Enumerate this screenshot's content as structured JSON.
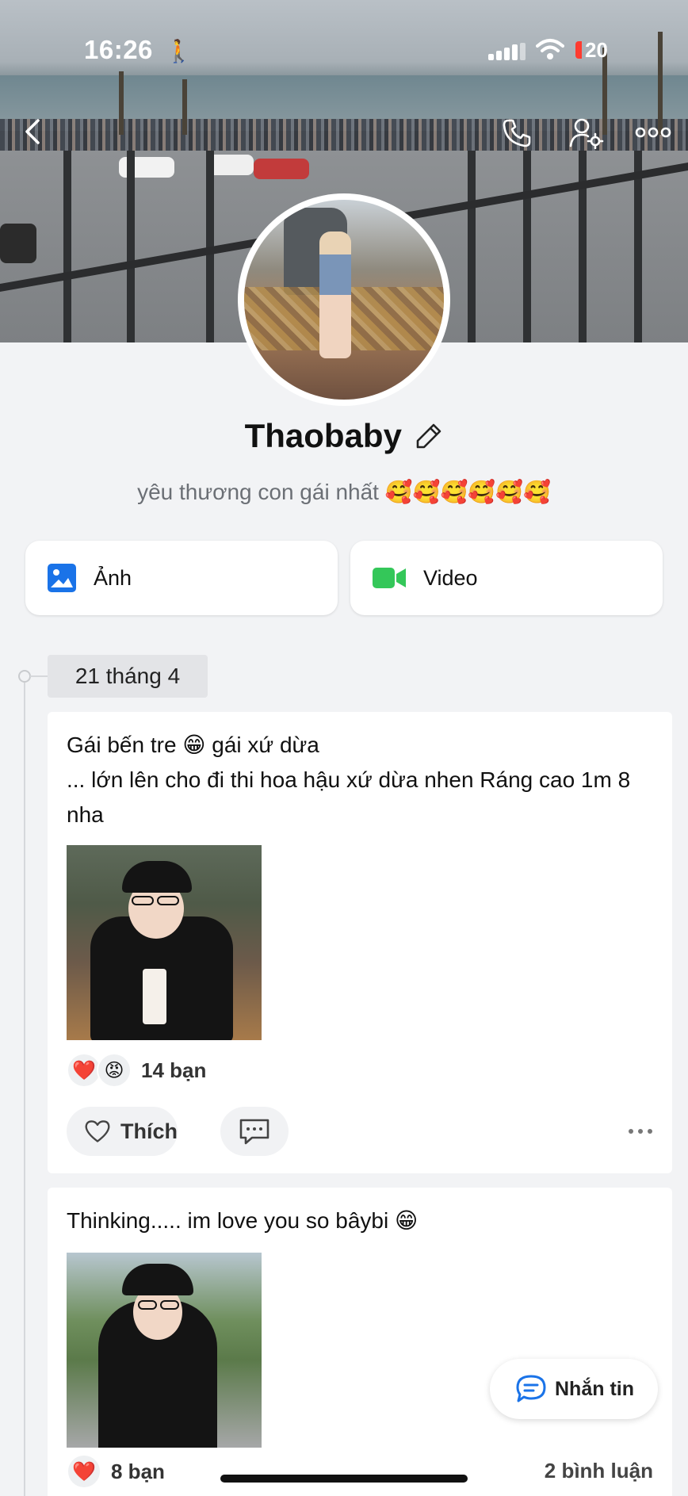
{
  "status_bar": {
    "time": "16:26",
    "battery": "20"
  },
  "profile": {
    "name": "Thaobaby",
    "bio": "yêu thương con gái nhất",
    "bio_emojis": "🥰🥰🥰🥰🥰🥰"
  },
  "media_tabs": {
    "photos_label": "Ảnh",
    "videos_label": "Video"
  },
  "timeline": {
    "date": "21 tháng 4"
  },
  "posts": [
    {
      "text": "Gái bến tre 😁 gái xứ dừa\n... lớn lên cho đi thi hoa hậu xứ dừa nhen Ráng cao 1m 8 nha",
      "reactions": [
        "❤️",
        "😡"
      ],
      "reaction_count": "14 bạn",
      "like_label": "Thích"
    },
    {
      "text": "Thinking..... im love you so bâybi 😁",
      "reactions": [
        "❤️"
      ],
      "reaction_count": "8 bạn",
      "comment_count": "2 bình luận"
    }
  ],
  "message_button": {
    "label": "Nhắn tin"
  },
  "colors": {
    "accent": "#1a73e8",
    "video_green": "#34c759",
    "background": "#f2f3f5"
  }
}
